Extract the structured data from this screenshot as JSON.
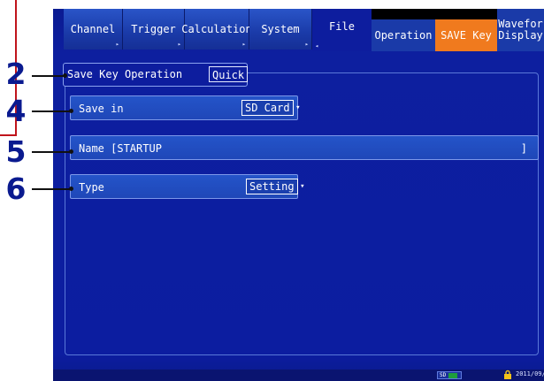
{
  "callouts": [
    "2",
    "4",
    "5",
    "6"
  ],
  "tabs": {
    "channel": "Channel",
    "trigger": "Trigger",
    "calculation": "Calculation",
    "system": "System",
    "file": "File"
  },
  "subtabs": {
    "operation": "Operation",
    "save_key": "SAVE Key",
    "waveform_line1": "Wavefor",
    "waveform_line2": "Display"
  },
  "group": {
    "title": "Save Key Operation",
    "mode": "Quick"
  },
  "rows": {
    "save_in": {
      "label": "Save in",
      "value": "SD Card"
    },
    "name": {
      "label": "Name [STARTUP",
      "end": "]"
    },
    "type": {
      "label": "Type",
      "value": "Setting"
    }
  },
  "status": {
    "media": "SD",
    "date": "2011/09/"
  },
  "colors": {
    "panel": "#0d1d9e",
    "active_subtab": "#f07a1e",
    "callout_number": "#0a1a8f",
    "callout_line": "#c0141b"
  }
}
